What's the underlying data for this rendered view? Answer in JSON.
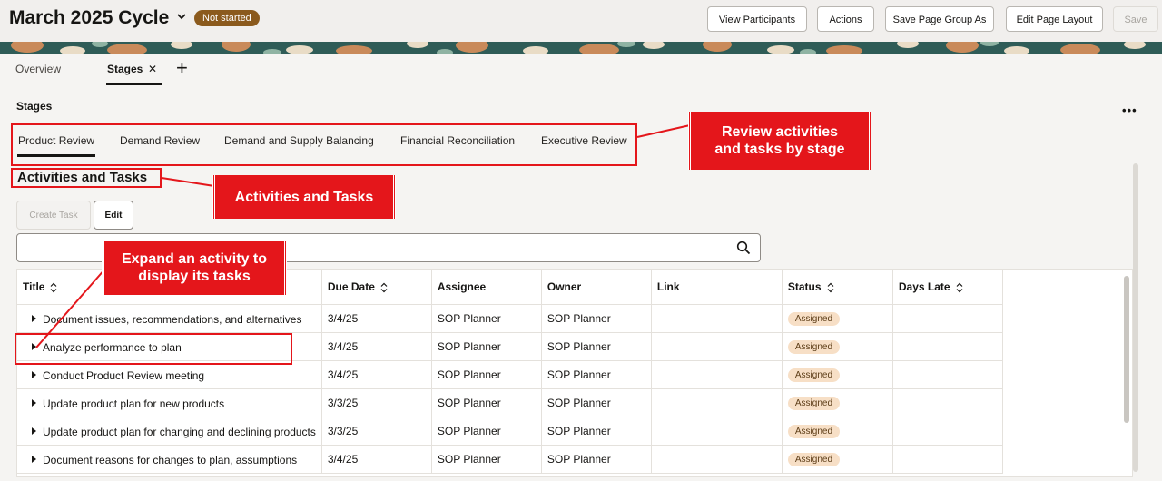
{
  "header": {
    "title": "March 2025 Cycle",
    "status": "Not started",
    "buttons": {
      "view_participants": "View Participants",
      "actions": "Actions",
      "save_page_group_as": "Save Page Group As",
      "edit_page_layout": "Edit Page Layout",
      "save": "Save"
    }
  },
  "page_tabs": {
    "overview": "Overview",
    "stages": "Stages"
  },
  "stages": {
    "heading": "Stages",
    "tabs": [
      "Product Review",
      "Demand Review",
      "Demand and Supply Balancing",
      "Financial Reconciliation",
      "Executive Review"
    ]
  },
  "activities": {
    "title": "Activities and Tasks",
    "create_task": "Create Task",
    "edit": "Edit"
  },
  "table": {
    "columns": [
      "Title",
      "Due Date",
      "Assignee",
      "Owner",
      "Link",
      "Status",
      "Days Late"
    ],
    "rows": [
      {
        "title": "Document issues, recommendations, and alternatives",
        "due": "3/4/25",
        "assignee": "SOP Planner",
        "owner": "SOP Planner",
        "link": "",
        "status": "Assigned",
        "days_late": ""
      },
      {
        "title": "Analyze performance to plan",
        "due": "3/4/25",
        "assignee": "SOP Planner",
        "owner": "SOP Planner",
        "link": "",
        "status": "Assigned",
        "days_late": ""
      },
      {
        "title": "Conduct Product Review meeting",
        "due": "3/4/25",
        "assignee": "SOP Planner",
        "owner": "SOP Planner",
        "link": "",
        "status": "Assigned",
        "days_late": ""
      },
      {
        "title": "Update product plan for new products",
        "due": "3/3/25",
        "assignee": "SOP Planner",
        "owner": "SOP Planner",
        "link": "",
        "status": "Assigned",
        "days_late": ""
      },
      {
        "title": "Update product plan for changing and declining products",
        "due": "3/3/25",
        "assignee": "SOP Planner",
        "owner": "SOP Planner",
        "link": "",
        "status": "Assigned",
        "days_late": ""
      },
      {
        "title": "Document reasons for changes to plan, assumptions",
        "due": "3/4/25",
        "assignee": "SOP Planner",
        "owner": "SOP Planner",
        "link": "",
        "status": "Assigned",
        "days_late": ""
      }
    ]
  },
  "callouts": {
    "review": "Review activities and tasks by stage",
    "activities": "Activities and Tasks",
    "expand": "Expand an activity to display its tasks"
  },
  "colors": {
    "accent_red": "#e4161b",
    "status_pill": "#8b5a1d",
    "assigned_badge": "#f7dfc6"
  }
}
